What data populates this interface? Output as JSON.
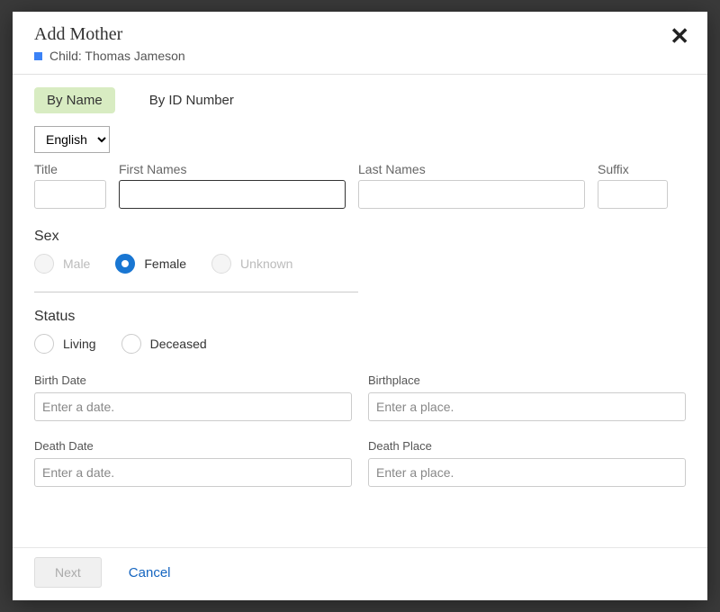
{
  "header": {
    "title": "Add Mother",
    "child_label": "Child: Thomas Jameson"
  },
  "tabs": {
    "by_name": "By Name",
    "by_id": "By ID Number"
  },
  "language": {
    "selected": "English"
  },
  "name_fields": {
    "title_label": "Title",
    "first_label": "First Names",
    "last_label": "Last Names",
    "suffix_label": "Suffix"
  },
  "sex": {
    "section_label": "Sex",
    "male": "Male",
    "female": "Female",
    "unknown": "Unknown",
    "selected": "female"
  },
  "status": {
    "section_label": "Status",
    "living": "Living",
    "deceased": "Deceased"
  },
  "birth": {
    "date_label": "Birth Date",
    "date_placeholder": "Enter a date.",
    "place_label": "Birthplace",
    "place_placeholder": "Enter a place."
  },
  "death": {
    "date_label": "Death Date",
    "date_placeholder": "Enter a date.",
    "place_label": "Death Place",
    "place_placeholder": "Enter a place."
  },
  "footer": {
    "next": "Next",
    "cancel": "Cancel"
  }
}
